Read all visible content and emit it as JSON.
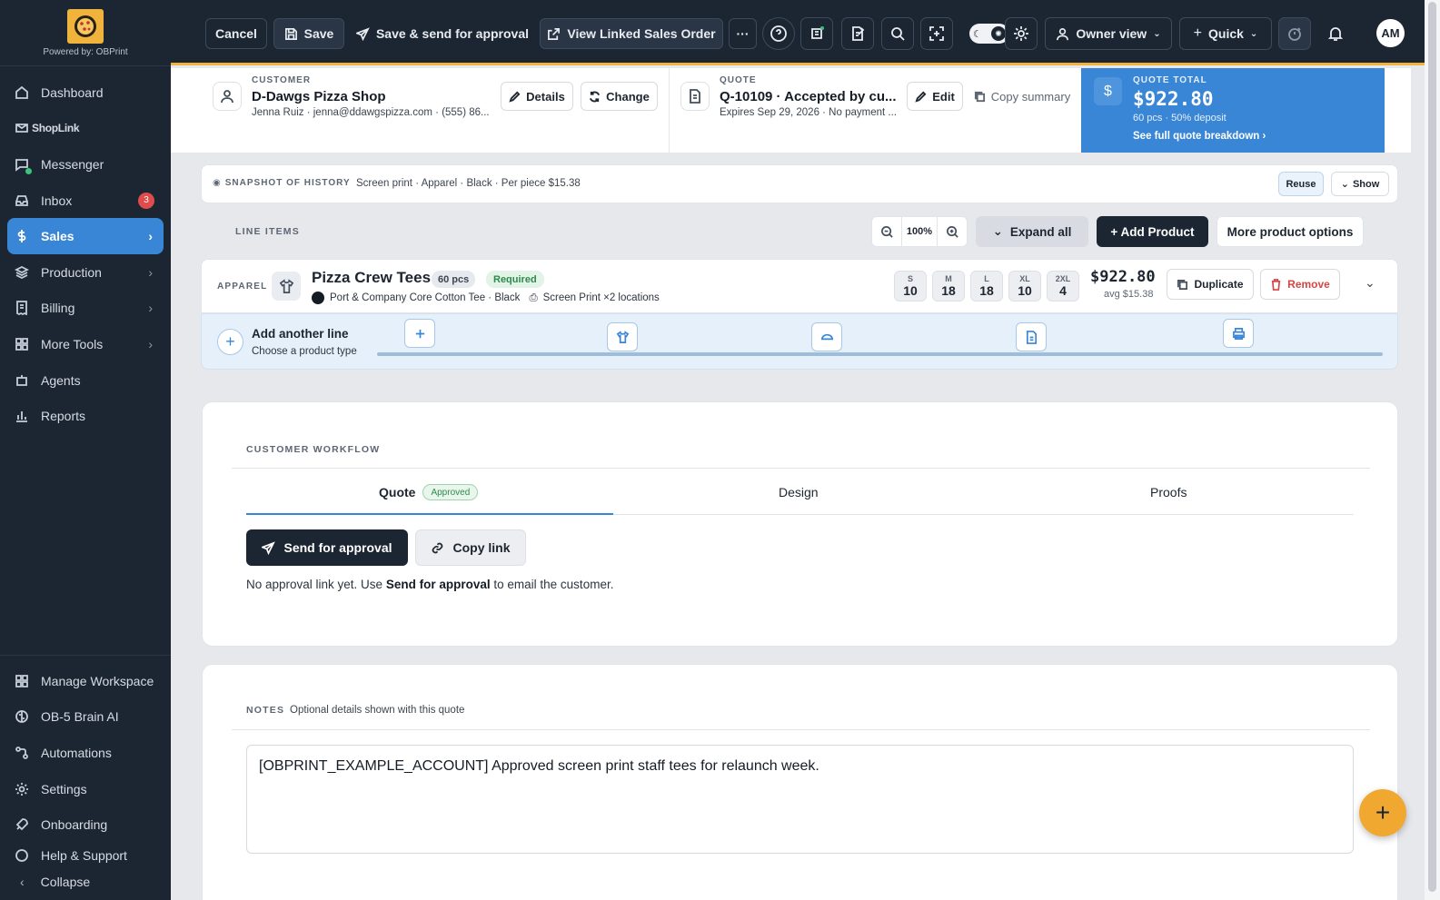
{
  "sidebar": {
    "powered_by": "Powered by: OBPrint",
    "items": [
      {
        "label": "Dashboard"
      },
      {
        "label": "ShopLink"
      },
      {
        "label": "Messenger"
      },
      {
        "label": "Inbox",
        "badge": "3"
      },
      {
        "label": "Sales"
      },
      {
        "label": "Production"
      },
      {
        "label": "Billing"
      },
      {
        "label": "More Tools"
      },
      {
        "label": "Agents"
      },
      {
        "label": "Reports"
      }
    ],
    "bottom_items": [
      {
        "label": "Manage Workspace"
      },
      {
        "label": "OB-5 Brain AI"
      },
      {
        "label": "Automations"
      },
      {
        "label": "Settings"
      },
      {
        "label": "Onboarding"
      },
      {
        "label": "Help & Support"
      }
    ],
    "collapse_label": "Collapse"
  },
  "topbar": {
    "cancel": "Cancel",
    "save": "Save",
    "save_send": "Save & send for approval",
    "view_linked": "View Linked Sales Order",
    "more": "···",
    "owner_view": "Owner view",
    "quick": "Quick",
    "avatar": "AM"
  },
  "summary": {
    "customer_cap": "CUSTOMER",
    "customer_name": "D-Dawgs Pizza Shop",
    "customer_contact": "Jenna Ruiz · jenna@ddawgspizza.com · (555) 86...",
    "details": "Details",
    "change": "Change",
    "quote_cap": "QUOTE",
    "quote_title": "Q-10109 · Accepted by cu...",
    "quote_sub": "Expires Sep 29, 2026 · No payment ...",
    "edit": "Edit",
    "copy_summary": "Copy summary",
    "total_cap": "QUOTE TOTAL",
    "total_value": "$922.80",
    "total_sub": "60 pcs · 50% deposit",
    "total_link": "See full quote breakdown",
    "colors": {
      "accent": "#3a86d6"
    }
  },
  "snapshot": {
    "cap": "SNAPSHOT OF HISTORY",
    "text": "Screen print · Apparel · Black · Per piece $15.38",
    "reuse": "Reuse",
    "show": "Show"
  },
  "line_items": {
    "cap": "LINE ITEMS",
    "zoom": "100%",
    "expand_all": "Expand all",
    "add_product": "+ Add Product",
    "more_options": "More product options",
    "product": {
      "category": "APPAREL",
      "name": "Pizza Crew Tees",
      "qty": "60 pcs",
      "required": "Required",
      "garment": "Port & Company Core Cotton Tee · Black",
      "decoration": "Screen Print ×2 locations",
      "sizes": [
        {
          "label": "S",
          "qty": "10"
        },
        {
          "label": "M",
          "qty": "18"
        },
        {
          "label": "L",
          "qty": "18"
        },
        {
          "label": "XL",
          "qty": "10"
        },
        {
          "label": "2XL",
          "qty": "4"
        }
      ],
      "price": "$922.80",
      "avg": "avg $15.38",
      "duplicate": "Duplicate",
      "remove": "Remove"
    },
    "add_line": {
      "title": "Add another line",
      "sub": "Choose a product type"
    }
  },
  "workflow": {
    "cap": "CUSTOMER WORKFLOW",
    "tabs": [
      {
        "label": "Quote",
        "badge": "Approved"
      },
      {
        "label": "Design"
      },
      {
        "label": "Proofs"
      }
    ],
    "send_for_approval": "Send for approval",
    "copy_link": "Copy link",
    "msg_pre": "No approval link yet. Use",
    "msg_bold": "Send for approval",
    "msg_post": "to email the customer."
  },
  "notes": {
    "cap": "NOTES",
    "sub": "Optional details shown with this quote",
    "value": "[OBPRINT_EXAMPLE_ACCOUNT] Approved screen print staff tees for relaunch week."
  },
  "fab": "+"
}
